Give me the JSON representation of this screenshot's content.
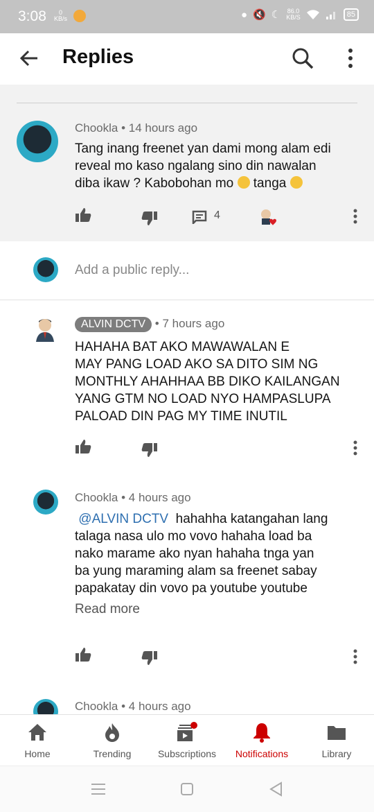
{
  "status_bar": {
    "time": "3:08",
    "net_speed_left": "0",
    "net_unit_left": "KB/s",
    "net_speed_right": "86.0",
    "net_unit_right": "KB/S",
    "battery": "85"
  },
  "header": {
    "title": "Replies"
  },
  "parent_comment": {
    "author": "Chookla",
    "time": "14 hours ago",
    "text_line1": "Tang inang freenet yan dami mong alam edi",
    "text_line2": "reveal mo kaso ngalang sino din nawalan",
    "text_line3a": "diba ikaw ? Kabobohan mo",
    "text_line3b": "tanga",
    "reply_count": "4"
  },
  "reply_input": {
    "placeholder": "Add a public reply..."
  },
  "replies": [
    {
      "author": "ALVIN DCTV",
      "time": "7 hours ago",
      "lines": [
        "HAHAHA BAT AKO MAWAWALAN E",
        "MAY PANG LOAD AKO SA DITO SIM NG",
        "MONTHLY AHAHHAA BB DIKO KAILANGAN",
        "YANG GTM NO LOAD NYO HAMPASLUPA",
        "PALOAD DIN PAG MY TIME INUTIL"
      ]
    },
    {
      "author": "Chookla",
      "time": "4 hours ago",
      "mention": "@ALVIN DCTV",
      "lines": [
        "hahahha katangahan lang",
        "talaga nasa ulo mo vovo hahaha load ba",
        "nako marame ako nyan hahaha tnga yan",
        "ba yung maraming alam sa freenet sabay",
        "papakatay din vovo pa youtube youtube"
      ],
      "read_more": "Read more"
    },
    {
      "author": "Chookla",
      "time": "4 hours ago"
    }
  ],
  "separator": "•",
  "bottom_nav": {
    "home": "Home",
    "trending": "Trending",
    "subscriptions": "Subscriptions",
    "notifications": "Notifications",
    "library": "Library"
  },
  "colors": {
    "active": "#cc0000",
    "badge": "#7d7d7d",
    "mention": "#2e6fb0"
  }
}
